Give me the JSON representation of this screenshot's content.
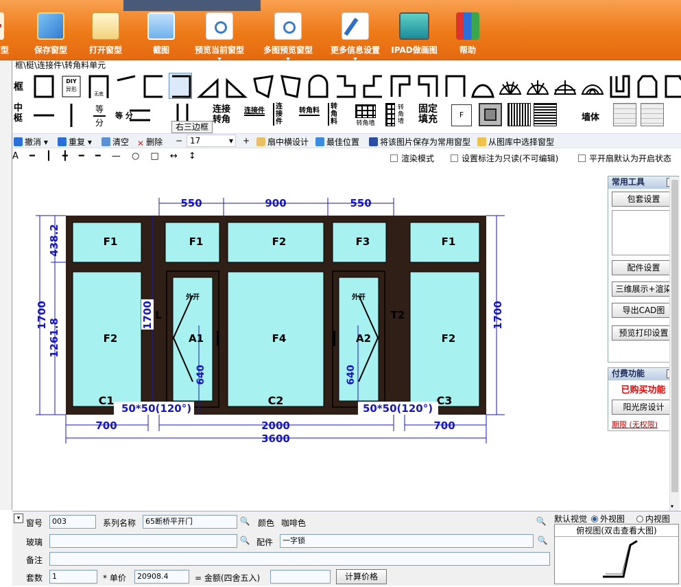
{
  "toolbar": {
    "items": [
      {
        "label": "窗型",
        "icon": "plus-icon"
      },
      {
        "label": "保存窗型",
        "icon": "save-window-icon"
      },
      {
        "label": "打开窗型",
        "icon": "open-window-icon"
      },
      {
        "label": "截图",
        "icon": "screenshot-icon"
      },
      {
        "label": "预览当前窗型",
        "icon": "preview-magnifier-icon"
      },
      {
        "label": "多图预览窗型",
        "icon": "multi-preview-icon"
      },
      {
        "label": "更多信息设置",
        "icon": "settings-edit-icon"
      },
      {
        "label": "IPAD做画图",
        "icon": "ipad-drawing-icon"
      },
      {
        "label": "帮助",
        "icon": "help-books-icon"
      }
    ]
  },
  "breadcrumb": "框\\梃\\连接件\\转角料单元",
  "shapes_row1_label": "框",
  "shapes_row2_label": "中梃",
  "row2_text": {
    "deng_fen_a": "等",
    "deng_fen_b": "分",
    "deng_fen2_a": "等",
    "deng_fen2_b": "分",
    "lianjie_zhuanjiao_a": "连接",
    "lianjie_zhuanjiao_b": "转角",
    "lianjiejian": "连接件",
    "lianjiejian_v": "连接件",
    "zhuanjiaoliao": "转角料",
    "zhuanjiaoliao_v": "转角料",
    "zhuanjiaoqiang": "转角墙",
    "zhuanjiaoqiang_v": "转角墙",
    "guding_a": "固定",
    "guding_b": "填充",
    "f_label": "F",
    "qiangti": "墙体"
  },
  "tooltip": "右三边框",
  "edit_toolbar": {
    "undo": "撤消",
    "redo": "重复",
    "clear": "清空",
    "delete": "删除",
    "minus": "−",
    "size_value": "17",
    "plus": "+",
    "sash_design": "扇中横设计",
    "best_position": "最佳位置",
    "save_as_common": "将该图片保存为常用窗型",
    "choose_from_library": "从图库中选择窗型"
  },
  "draw_tools": "A ━ ┃ ╋ ━ ━ — ○ □ ↔ ↕",
  "checkboxes": [
    {
      "label": "渲染模式",
      "checked": false
    },
    {
      "label": "设置标注为只读(不可编辑)",
      "checked": false
    },
    {
      "label": "平开扇默认为开启状态",
      "checked": false
    }
  ],
  "drawing": {
    "top_dims": [
      "550",
      "900",
      "550"
    ],
    "bottom_dims": [
      "700",
      "2000",
      "700"
    ],
    "total_width": "3600",
    "left_outer_height": "1700",
    "left_top_height": "438.2",
    "left_bottom_height": "1261.8",
    "right_height": "1700",
    "mid_height": "1700",
    "handle_height_1": "640",
    "handle_height_2": "640",
    "panes": [
      "F1",
      "F1",
      "F2",
      "F3",
      "F1",
      "F2",
      "A1",
      "F4",
      "A2",
      "F2"
    ],
    "sections": [
      "C1",
      "C2",
      "C3"
    ],
    "open_label_1": "外开",
    "open_label_2": "外开",
    "mullion_l": "L",
    "mullion_t2": "T2",
    "corner_1": "50*50(120°)",
    "corner_2": "50*50(120°)"
  },
  "tools_panel": {
    "title": "常用工具",
    "close": "×",
    "package": "包套设置",
    "parts": "配件设置",
    "render3d": "三维展示+渲染",
    "export_cad": "导出CAD图",
    "print_preview": "预览打印设置"
  },
  "paid_panel": {
    "title": "付费功能",
    "close": "×",
    "status": "已购买功能",
    "sunroom": "阳光房设计",
    "term": "期限 (无权限)"
  },
  "form": {
    "window_no_label": "窗号",
    "window_no": "003",
    "series_label": "系列名称",
    "series": "65断桥平开门",
    "color_label": "颜色",
    "color": "咖啡色",
    "glass_label": "玻璃",
    "glass": "",
    "parts_label": "配件",
    "parts": "一字锁",
    "remark_label": "备注",
    "remark": "",
    "qty_label": "套数",
    "qty": "1",
    "price_label": "* 单价",
    "price": "20908.4",
    "amount_label": "= 金额(四舍五入)",
    "amount": "",
    "calc_button": "计算价格",
    "default_view_label": "默认视觉",
    "outer_view": "外视图",
    "inner_view": "内视图",
    "top_view_title": "俯视图(双击查看大图)"
  }
}
